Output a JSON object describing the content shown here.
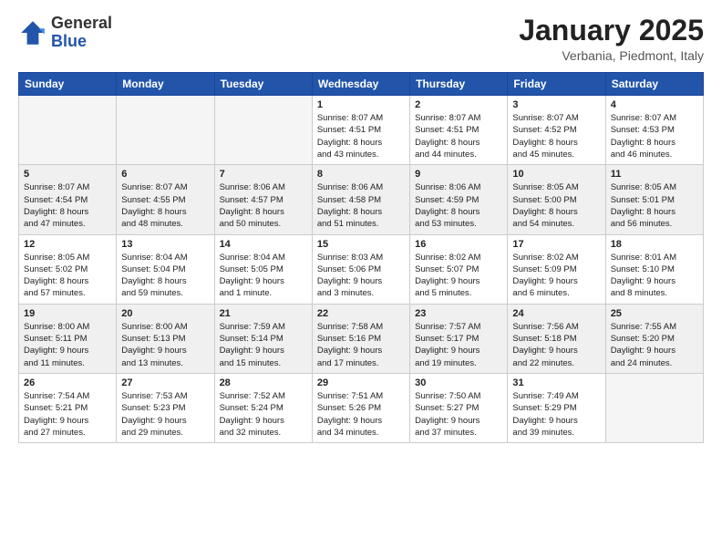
{
  "header": {
    "logo": {
      "general": "General",
      "blue": "Blue"
    },
    "title": "January 2025",
    "location": "Verbania, Piedmont, Italy"
  },
  "weekdays": [
    "Sunday",
    "Monday",
    "Tuesday",
    "Wednesday",
    "Thursday",
    "Friday",
    "Saturday"
  ],
  "weeks": [
    {
      "shaded": false,
      "days": [
        {
          "num": "",
          "info": ""
        },
        {
          "num": "",
          "info": ""
        },
        {
          "num": "",
          "info": ""
        },
        {
          "num": "1",
          "info": "Sunrise: 8:07 AM\nSunset: 4:51 PM\nDaylight: 8 hours\nand 43 minutes."
        },
        {
          "num": "2",
          "info": "Sunrise: 8:07 AM\nSunset: 4:51 PM\nDaylight: 8 hours\nand 44 minutes."
        },
        {
          "num": "3",
          "info": "Sunrise: 8:07 AM\nSunset: 4:52 PM\nDaylight: 8 hours\nand 45 minutes."
        },
        {
          "num": "4",
          "info": "Sunrise: 8:07 AM\nSunset: 4:53 PM\nDaylight: 8 hours\nand 46 minutes."
        }
      ]
    },
    {
      "shaded": true,
      "days": [
        {
          "num": "5",
          "info": "Sunrise: 8:07 AM\nSunset: 4:54 PM\nDaylight: 8 hours\nand 47 minutes."
        },
        {
          "num": "6",
          "info": "Sunrise: 8:07 AM\nSunset: 4:55 PM\nDaylight: 8 hours\nand 48 minutes."
        },
        {
          "num": "7",
          "info": "Sunrise: 8:06 AM\nSunset: 4:57 PM\nDaylight: 8 hours\nand 50 minutes."
        },
        {
          "num": "8",
          "info": "Sunrise: 8:06 AM\nSunset: 4:58 PM\nDaylight: 8 hours\nand 51 minutes."
        },
        {
          "num": "9",
          "info": "Sunrise: 8:06 AM\nSunset: 4:59 PM\nDaylight: 8 hours\nand 53 minutes."
        },
        {
          "num": "10",
          "info": "Sunrise: 8:05 AM\nSunset: 5:00 PM\nDaylight: 8 hours\nand 54 minutes."
        },
        {
          "num": "11",
          "info": "Sunrise: 8:05 AM\nSunset: 5:01 PM\nDaylight: 8 hours\nand 56 minutes."
        }
      ]
    },
    {
      "shaded": false,
      "days": [
        {
          "num": "12",
          "info": "Sunrise: 8:05 AM\nSunset: 5:02 PM\nDaylight: 8 hours\nand 57 minutes."
        },
        {
          "num": "13",
          "info": "Sunrise: 8:04 AM\nSunset: 5:04 PM\nDaylight: 8 hours\nand 59 minutes."
        },
        {
          "num": "14",
          "info": "Sunrise: 8:04 AM\nSunset: 5:05 PM\nDaylight: 9 hours\nand 1 minute."
        },
        {
          "num": "15",
          "info": "Sunrise: 8:03 AM\nSunset: 5:06 PM\nDaylight: 9 hours\nand 3 minutes."
        },
        {
          "num": "16",
          "info": "Sunrise: 8:02 AM\nSunset: 5:07 PM\nDaylight: 9 hours\nand 5 minutes."
        },
        {
          "num": "17",
          "info": "Sunrise: 8:02 AM\nSunset: 5:09 PM\nDaylight: 9 hours\nand 6 minutes."
        },
        {
          "num": "18",
          "info": "Sunrise: 8:01 AM\nSunset: 5:10 PM\nDaylight: 9 hours\nand 8 minutes."
        }
      ]
    },
    {
      "shaded": true,
      "days": [
        {
          "num": "19",
          "info": "Sunrise: 8:00 AM\nSunset: 5:11 PM\nDaylight: 9 hours\nand 11 minutes."
        },
        {
          "num": "20",
          "info": "Sunrise: 8:00 AM\nSunset: 5:13 PM\nDaylight: 9 hours\nand 13 minutes."
        },
        {
          "num": "21",
          "info": "Sunrise: 7:59 AM\nSunset: 5:14 PM\nDaylight: 9 hours\nand 15 minutes."
        },
        {
          "num": "22",
          "info": "Sunrise: 7:58 AM\nSunset: 5:16 PM\nDaylight: 9 hours\nand 17 minutes."
        },
        {
          "num": "23",
          "info": "Sunrise: 7:57 AM\nSunset: 5:17 PM\nDaylight: 9 hours\nand 19 minutes."
        },
        {
          "num": "24",
          "info": "Sunrise: 7:56 AM\nSunset: 5:18 PM\nDaylight: 9 hours\nand 22 minutes."
        },
        {
          "num": "25",
          "info": "Sunrise: 7:55 AM\nSunset: 5:20 PM\nDaylight: 9 hours\nand 24 minutes."
        }
      ]
    },
    {
      "shaded": false,
      "days": [
        {
          "num": "26",
          "info": "Sunrise: 7:54 AM\nSunset: 5:21 PM\nDaylight: 9 hours\nand 27 minutes."
        },
        {
          "num": "27",
          "info": "Sunrise: 7:53 AM\nSunset: 5:23 PM\nDaylight: 9 hours\nand 29 minutes."
        },
        {
          "num": "28",
          "info": "Sunrise: 7:52 AM\nSunset: 5:24 PM\nDaylight: 9 hours\nand 32 minutes."
        },
        {
          "num": "29",
          "info": "Sunrise: 7:51 AM\nSunset: 5:26 PM\nDaylight: 9 hours\nand 34 minutes."
        },
        {
          "num": "30",
          "info": "Sunrise: 7:50 AM\nSunset: 5:27 PM\nDaylight: 9 hours\nand 37 minutes."
        },
        {
          "num": "31",
          "info": "Sunrise: 7:49 AM\nSunset: 5:29 PM\nDaylight: 9 hours\nand 39 minutes."
        },
        {
          "num": "",
          "info": ""
        }
      ]
    }
  ]
}
